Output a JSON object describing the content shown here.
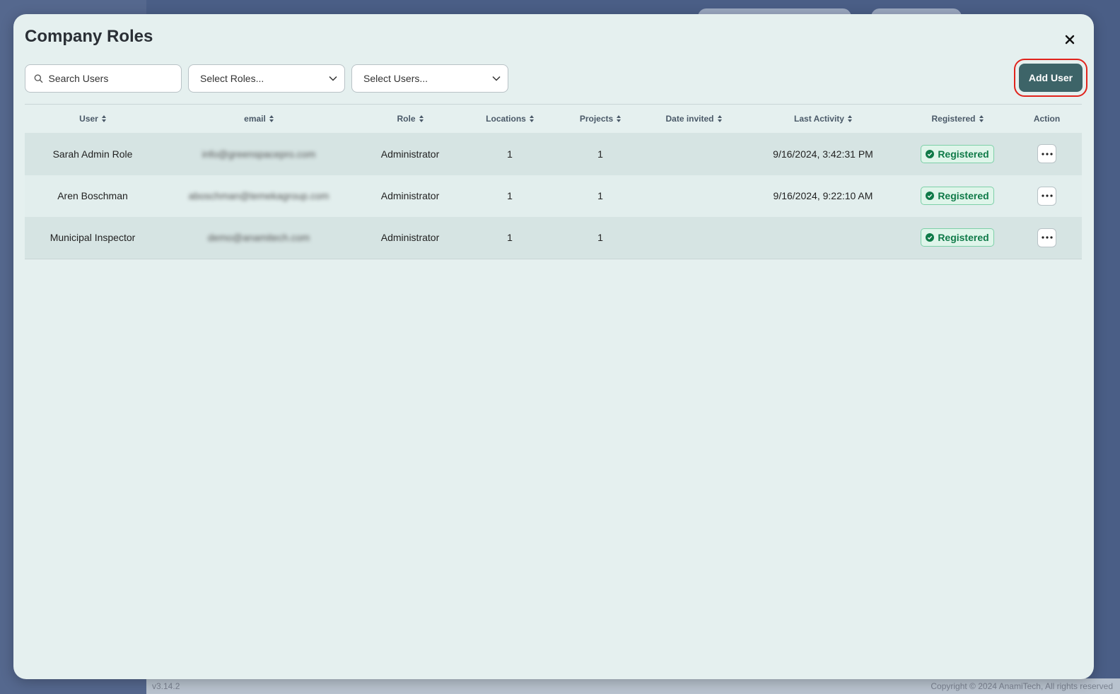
{
  "modal": {
    "title": "Company Roles"
  },
  "toolbar": {
    "search_placeholder": "Search Users",
    "roles_select": "Select Roles...",
    "users_select": "Select Users...",
    "add_user_label": "Add User"
  },
  "table": {
    "columns": [
      "User",
      "email",
      "Role",
      "Locations",
      "Projects",
      "Date invited",
      "Last Activity",
      "Registered",
      "Action"
    ],
    "rows": [
      {
        "user": "Sarah Admin Role",
        "email": "info@greenspacepro.com",
        "role": "Administrator",
        "locations": "1",
        "projects": "1",
        "date_invited": "",
        "last_activity": "9/16/2024, 3:42:31 PM",
        "registered": "Registered"
      },
      {
        "user": "Aren Boschman",
        "email": "aboschman@temekagroup.com",
        "role": "Administrator",
        "locations": "1",
        "projects": "1",
        "date_invited": "",
        "last_activity": "9/16/2024, 9:22:10 AM",
        "registered": "Registered"
      },
      {
        "user": "Municipal Inspector",
        "email": "demo@anamitech.com",
        "role": "Administrator",
        "locations": "1",
        "projects": "1",
        "date_invited": "",
        "last_activity": "",
        "registered": "Registered"
      }
    ]
  },
  "footer": {
    "version": "v3.14.2",
    "copyright": "Copyright © 2024 AnamiTech, All rights reserved"
  },
  "colors": {
    "accent": "#3d6468",
    "badge_text": "#0f7a48",
    "highlight": "#e0231c"
  },
  "icons": {
    "search": "search-icon",
    "chevron": "chevron-down-icon",
    "sort": "sort-icon",
    "close": "close-icon",
    "check": "check-circle-icon",
    "more": "more-horizontal-icon"
  }
}
